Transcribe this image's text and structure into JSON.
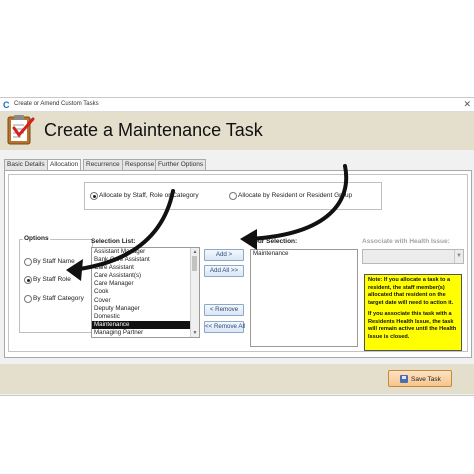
{
  "window": {
    "title": "Create or Amend Custom Tasks",
    "close_glyph": "✕"
  },
  "header": {
    "title": "Create a Maintenance Task"
  },
  "tabs": [
    {
      "label": "Basic Details"
    },
    {
      "label": "Allocation"
    },
    {
      "label": "Recurrence"
    },
    {
      "label": "Response"
    },
    {
      "label": "Further Options"
    }
  ],
  "allocation_mode": {
    "by_staff_label": "Allocate by Staff, Role or Category",
    "by_resident_label": "Allocate by Resident or Resident Group",
    "selected": "by_staff"
  },
  "options": {
    "legend": "Options",
    "items": [
      {
        "label": "By Staff Name",
        "checked": false
      },
      {
        "label": "By Staff Role",
        "checked": true
      },
      {
        "label": "By Staff Category",
        "checked": false
      }
    ]
  },
  "selection_list": {
    "label": "Selection List:",
    "items": [
      "Assistant Manager",
      "Bank Care Assistant",
      "Care Assistant",
      "Care Assistant(s)",
      "Care Manager",
      "Cook",
      "Cover",
      "Deputy Manager",
      "Domestic",
      "Maintenance",
      "Managing Partner"
    ],
    "selected": "Maintenance"
  },
  "buttons": {
    "add": "Add >",
    "add_all": "Add All >>",
    "remove": "< Remove",
    "remove_all": "<< Remove All",
    "save": "Save Task"
  },
  "your_selection": {
    "label": "Your Selection:",
    "items": [
      "Maintenance"
    ]
  },
  "health_issue": {
    "label": "Associate with Health Issue:",
    "value": ""
  },
  "note": {
    "paragraph1": "Note: If you allocate a task to a resident, the staff member(s) allocated that resident on the target date will need to action it.",
    "paragraph2": "If you associate this task with a Residents Health Issue, the task will remain active until the Health Issue is closed."
  },
  "icons": {
    "app": "app-logo-icon",
    "task": "clipboard-check-icon",
    "save": "floppy-disk-icon",
    "annotation": "arrow-annotation"
  },
  "colors": {
    "header_bg": "#e4dfcc",
    "note_bg": "#ffff00",
    "selected_item_bg": "#111111",
    "save_button_bg": "#f7c58d"
  }
}
